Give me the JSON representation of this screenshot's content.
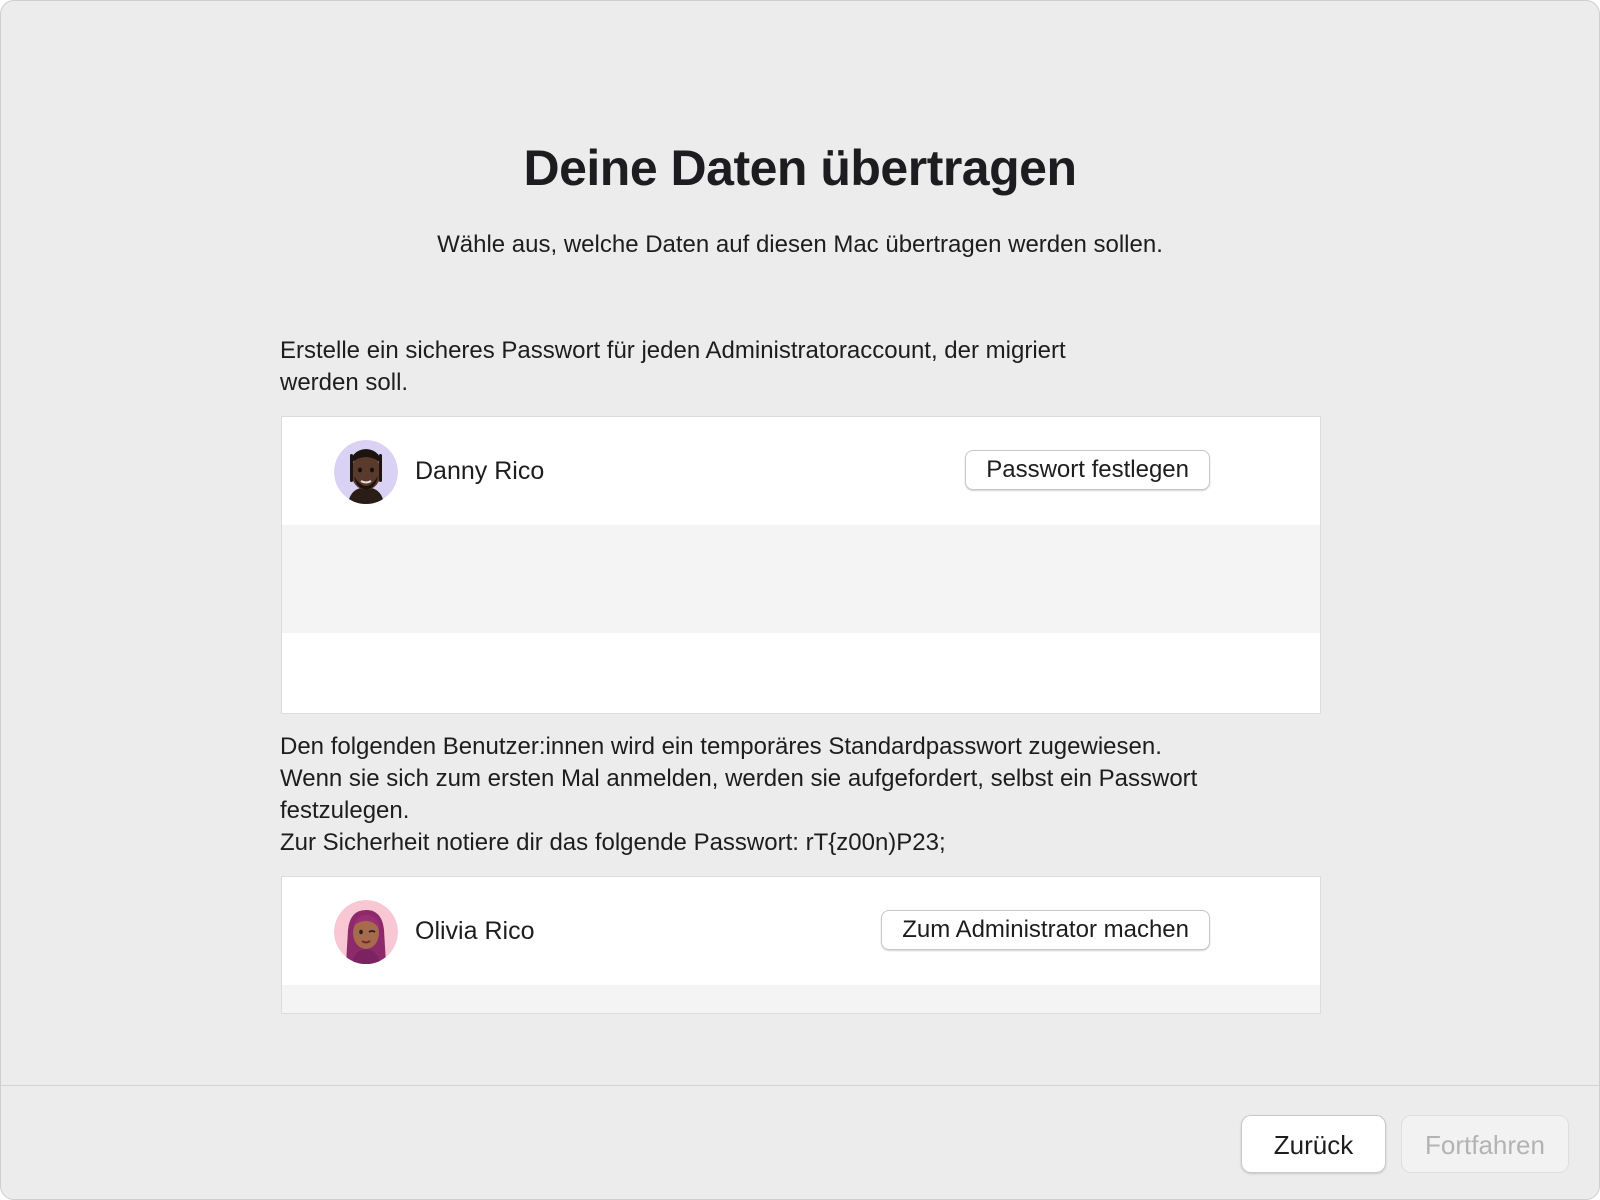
{
  "header": {
    "title": "Deine Daten übertragen",
    "subtitle": "Wähle aus, welche Daten auf diesen Mac übertragen werden sollen."
  },
  "admin_section": {
    "instruction_lines": [
      "Erstelle ein sicheres Passwort für jeden Administratoraccount, der migriert",
      "werden soll."
    ],
    "users": [
      {
        "name": "Danny Rico",
        "avatar_icon": "memoji-man-avatar-icon",
        "avatar_bg": "#d9d2f5",
        "button_label": "Passwort festlegen"
      }
    ]
  },
  "standard_section": {
    "instruction_lines": [
      "Den folgenden Benutzer:innen wird ein temporäres Standardpasswort zugewiesen.",
      "Wenn sie sich zum ersten Mal anmelden, werden sie aufgefordert, selbst ein Passwort",
      "festzulegen.",
      "Zur Sicherheit notiere dir das folgende Passwort: rT{z00n)P23;"
    ],
    "users": [
      {
        "name": "Olivia Rico",
        "avatar_icon": "memoji-woman-avatar-icon",
        "avatar_bg": "#f9c6d3",
        "button_label": "Zum Administrator machen"
      }
    ]
  },
  "footer": {
    "back_label": "Zurück",
    "continue_label": "Fortfahren"
  }
}
